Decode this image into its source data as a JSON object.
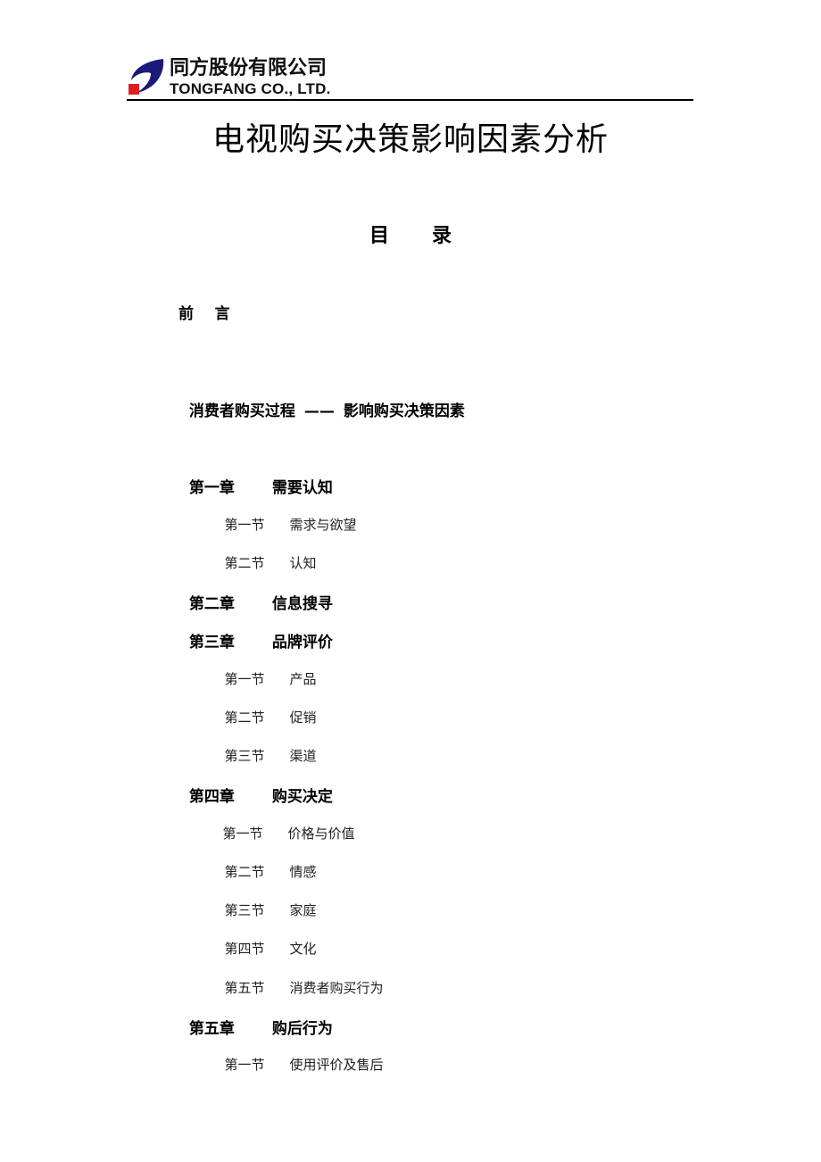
{
  "header": {
    "company_cn": "同方股份有限公司",
    "company_en": "TONGFANG CO., LTD.",
    "logo_colors": {
      "swoosh": "#1a1a7a",
      "square": "#e02020"
    }
  },
  "document": {
    "title": "电视购买决策影响因素分析",
    "toc_heading": [
      "目",
      "录"
    ]
  },
  "toc": {
    "preface": "前    言",
    "process": {
      "left": "消费者购买过程",
      "separator": "——",
      "right": "影响购买决策因素"
    },
    "chapters": [
      {
        "number": "第一章",
        "title": "需要认知",
        "sections": [
          {
            "number": "第一节",
            "title": "需求与欲望"
          },
          {
            "number": "第二节",
            "title": "认知"
          }
        ]
      },
      {
        "number": "第二章",
        "title": "信息搜寻",
        "sections": []
      },
      {
        "number": "第三章",
        "title": "品牌评价",
        "sections": [
          {
            "number": "第一节",
            "title": "产品"
          },
          {
            "number": "第二节",
            "title": "促销"
          },
          {
            "number": "第三节",
            "title": "渠道"
          }
        ]
      },
      {
        "number": "第四章",
        "title": "购买决定",
        "sections": [
          {
            "number": "第一节",
            "title": "价格与价值"
          },
          {
            "number": "第二节",
            "title": "情感"
          },
          {
            "number": "第三节",
            "title": "家庭"
          },
          {
            "number": "第四节",
            "title": "文化"
          },
          {
            "number": "第五节",
            "title": "消费者购买行为"
          }
        ]
      },
      {
        "number": "第五章",
        "title": "购后行为",
        "sections": [
          {
            "number": "第一节",
            "title": "使用评价及售后"
          }
        ]
      }
    ]
  }
}
